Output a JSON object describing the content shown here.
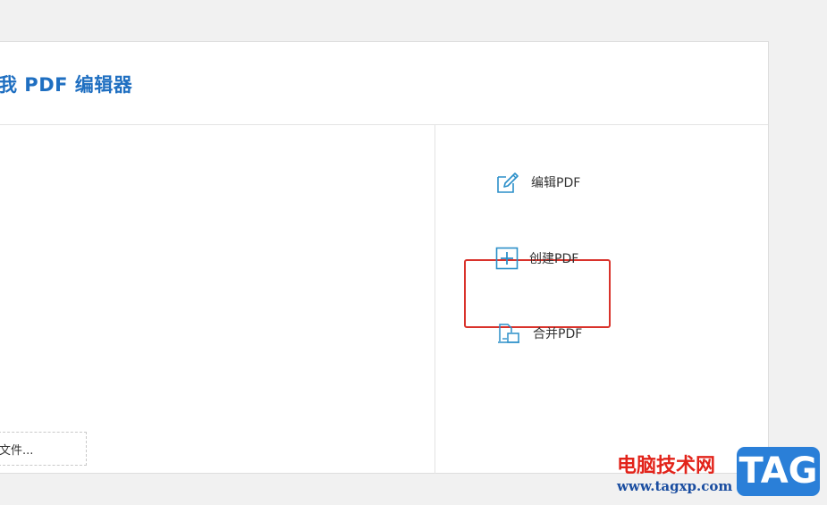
{
  "app": {
    "title": "我 PDF 编辑器"
  },
  "open_file": {
    "label": "文件..."
  },
  "actions": [
    {
      "id": "edit",
      "label": "编辑PDF",
      "icon": "edit-icon"
    },
    {
      "id": "create",
      "label": "创建PDF",
      "icon": "plus-square-icon"
    },
    {
      "id": "merge",
      "label": "合并PDF",
      "icon": "merge-icon"
    }
  ],
  "highlight": {
    "color": "#d9322b",
    "target": "create"
  },
  "watermark": {
    "text": "电脑技术网",
    "url": "www.tagxp.com",
    "logo": "TAG"
  },
  "colors": {
    "accent": "#1f6fc1",
    "icon": "#2b8fc9",
    "panel": "#ffffff",
    "background": "#f1f1f1"
  }
}
